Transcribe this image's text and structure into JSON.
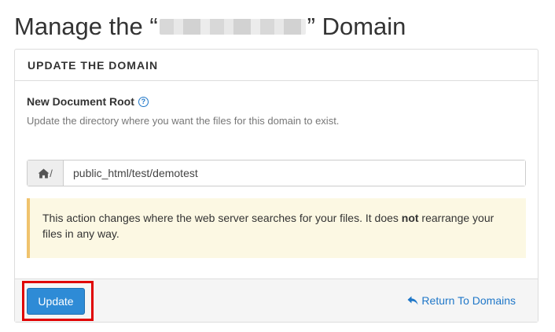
{
  "page": {
    "title_prefix": "Manage the “",
    "title_suffix": "” Domain"
  },
  "panel": {
    "heading": "UPDATE THE DOMAIN"
  },
  "field": {
    "label": "New Document Root",
    "help_icon_glyph": "?",
    "help_text": "Update the directory where you want the files for this domain to exist.",
    "addon_icon": "home-icon",
    "addon_separator": "/",
    "value": "public_html/test/demotest"
  },
  "alert": {
    "text_before": "This action changes where the web server searches for your files. It does ",
    "text_bold": "not",
    "text_after": " rearrange your files in any way."
  },
  "footer": {
    "update_label": "Update",
    "return_icon": "reply-arrow-icon",
    "return_label": "Return To Domains"
  },
  "colors": {
    "primary": "#2e8bd6",
    "link": "#1f77c8",
    "alert_bg": "#fcf8e3",
    "alert_border": "#f0c36d",
    "highlight": "#e00000"
  }
}
